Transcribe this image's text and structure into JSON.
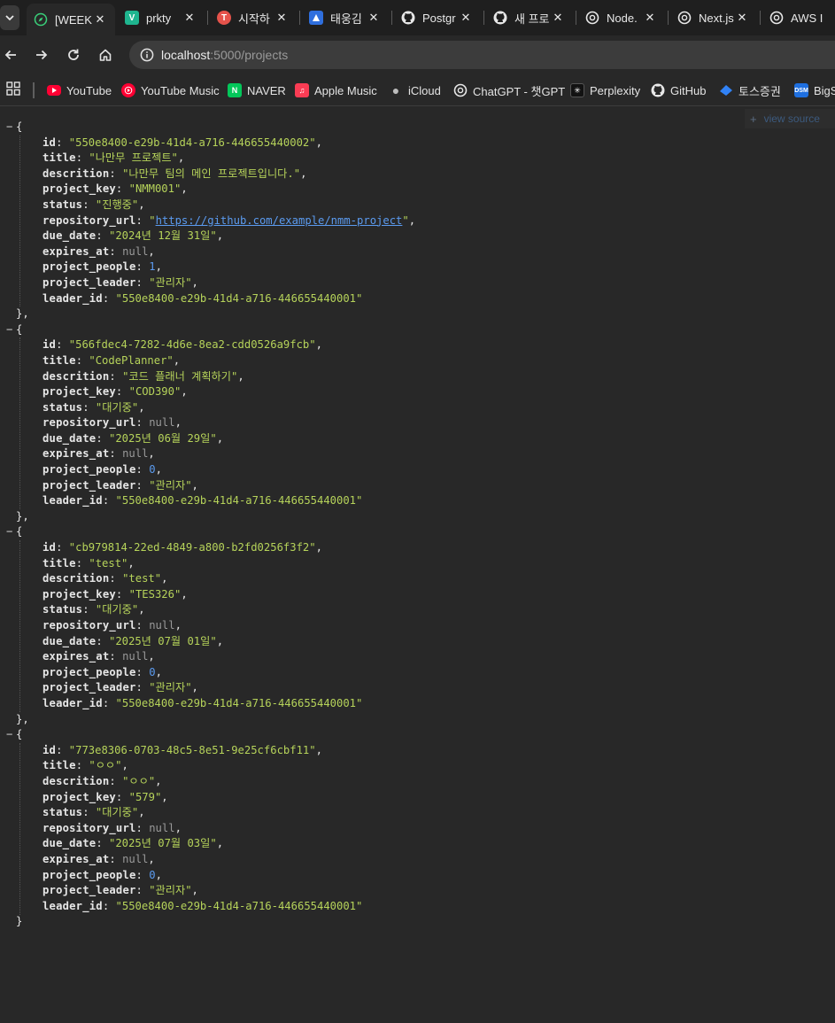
{
  "tabs": [
    {
      "label": "[WEEK",
      "icon": "compass-icon",
      "color": "#2e2e2e",
      "active": true
    },
    {
      "label": "prkty",
      "icon": "v-logo-icon",
      "color": "#1fb58f"
    },
    {
      "label": "시작하",
      "icon": "notion-like-icon",
      "color": "#e5534b"
    },
    {
      "label": "태웅김",
      "icon": "jira-icon",
      "color": "#2f6fde"
    },
    {
      "label": "Postgr",
      "icon": "github-icon",
      "color": "#e8e8e8"
    },
    {
      "label": "새 프로",
      "icon": "github-icon",
      "color": "#e8e8e8"
    },
    {
      "label": "Node.",
      "icon": "chatgpt-icon",
      "color": "#e8e8e8"
    },
    {
      "label": "Next.js",
      "icon": "chatgpt-icon",
      "color": "#e8e8e8"
    },
    {
      "label": "AWS I",
      "icon": "chatgpt-icon",
      "color": "#e8e8e8"
    }
  ],
  "address_bar": {
    "host": "localhost",
    "path": ":5000/projects"
  },
  "bookmarks": [
    {
      "label": "YouTube",
      "icon": "youtube-icon",
      "color": "#ff0033"
    },
    {
      "label": "YouTube Music",
      "icon": "youtube-music-icon",
      "color": "#ff0033"
    },
    {
      "label": "NAVER",
      "icon": "naver-icon",
      "color": "#03c75a"
    },
    {
      "label": "Apple Music",
      "icon": "apple-music-icon",
      "color": "#fa3c54"
    },
    {
      "label": "iCloud",
      "icon": "apple-icon",
      "color": "#bdbdbd"
    },
    {
      "label": "ChatGPT - 챗GPT",
      "icon": "chatgpt-icon",
      "color": "#e8e8e8"
    },
    {
      "label": "Perplexity",
      "icon": "perplexity-icon",
      "color": "#e8e8e8"
    },
    {
      "label": "GitHub",
      "icon": "github-icon",
      "color": "#e8e8e8"
    },
    {
      "label": "토스증권",
      "icon": "toss-icon",
      "color": "#3182f6"
    },
    {
      "label": "BigS",
      "icon": "dsm-icon",
      "color": "#1e6fe0"
    }
  ],
  "view_source_label": "view source",
  "projects": [
    {
      "id": "550e8400-e29b-41d4-a716-446655440002",
      "title": "나만무 프로젝트",
      "descrition": "나만무 팀의 메인 프로젝트입니다.",
      "project_key": "NMM001",
      "status": "진행중",
      "repository_url": "https://github.com/example/nmm-project",
      "due_date": "2024년 12월 31일",
      "expires_at": "null",
      "project_people": "1",
      "project_leader": "관리자",
      "leader_id": "550e8400-e29b-41d4-a716-446655440001"
    },
    {
      "id": "566fdec4-7282-4d6e-8ea2-cdd0526a9fcb",
      "title": "CodePlanner",
      "descrition": "코드 플래너 계획하기",
      "project_key": "COD390",
      "status": "대기중",
      "repository_url": "null",
      "due_date": "2025년 06월 29일",
      "expires_at": "null",
      "project_people": "0",
      "project_leader": "관리자",
      "leader_id": "550e8400-e29b-41d4-a716-446655440001"
    },
    {
      "id": "cb979814-22ed-4849-a800-b2fd0256f3f2",
      "title": "test",
      "descrition": "test",
      "project_key": "TES326",
      "status": "대기중",
      "repository_url": "null",
      "due_date": "2025년 07월 01일",
      "expires_at": "null",
      "project_people": "0",
      "project_leader": "관리자",
      "leader_id": "550e8400-e29b-41d4-a716-446655440001"
    },
    {
      "id": "773e8306-0703-48c5-8e51-9e25cf6cbf11",
      "title": "ㅇㅇ",
      "descrition": "ㅇㅇ",
      "project_key": "579",
      "status": "대기중",
      "repository_url": "null",
      "due_date": "2025년 07월 03일",
      "expires_at": "null",
      "project_people": "0",
      "project_leader": "관리자",
      "leader_id": "550e8400-e29b-41d4-a716-446655440001"
    }
  ]
}
